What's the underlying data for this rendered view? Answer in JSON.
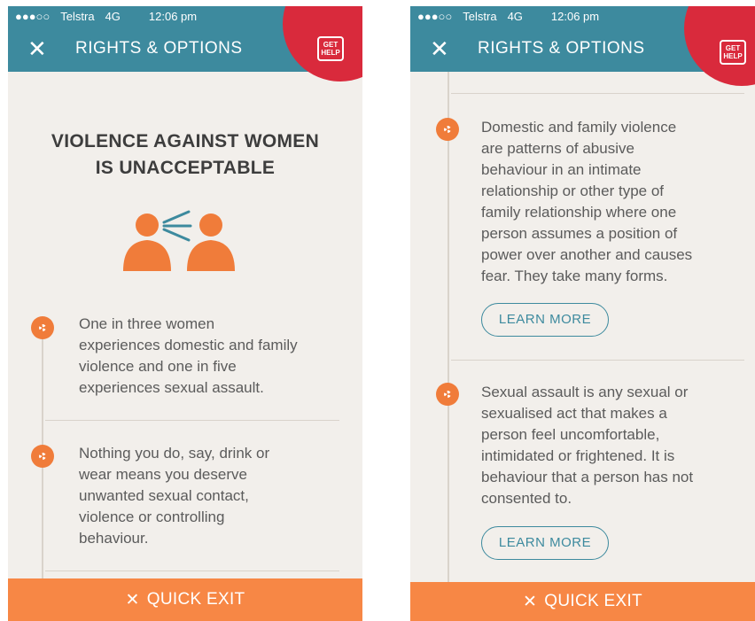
{
  "status": {
    "carrier": "Telstra",
    "network": "4G",
    "time": "12:06 pm"
  },
  "header": {
    "title": "RIGHTS & OPTIONS",
    "get_help_label": "GET HELP"
  },
  "left": {
    "headline_line1": "VIOLENCE AGAINST WOMEN",
    "headline_line2": "IS UNACCEPTABLE",
    "items": [
      {
        "text": [
          "One in three women",
          "experiences domestic and family",
          "violence and one in five",
          "experiences sexual assault."
        ]
      },
      {
        "text": [
          "Nothing you do, say, drink or",
          "wear means you deserve",
          "unwanted sexual contact,",
          "violence or controlling",
          "behaviour."
        ]
      }
    ]
  },
  "right": {
    "items": [
      {
        "text": [
          "Domestic and family violence",
          "are patterns of abusive",
          "behaviour in an intimate",
          "relationship or other type of",
          "family relationship where one",
          "person assumes a position of",
          "power over another and causes",
          "fear. They take many forms."
        ],
        "button": "LEARN MORE"
      },
      {
        "text": [
          "Sexual assault is any sexual or",
          "sexualised act that makes a",
          "person feel uncomfortable,",
          "intimidated or frightened. It is",
          "behaviour that a person has not",
          "consented to."
        ],
        "button": "LEARN MORE"
      }
    ]
  },
  "footer": {
    "quick_exit": "QUICK EXIT"
  },
  "colors": {
    "teal": "#3d8a9e",
    "orange": "#f07c3a",
    "red": "#d92a3c",
    "background": "#f2efeb"
  },
  "icons": {
    "close": "close-icon",
    "help": "help-badge-icon",
    "item": "orange-bullet-icon",
    "people": "people-talking-icon"
  }
}
